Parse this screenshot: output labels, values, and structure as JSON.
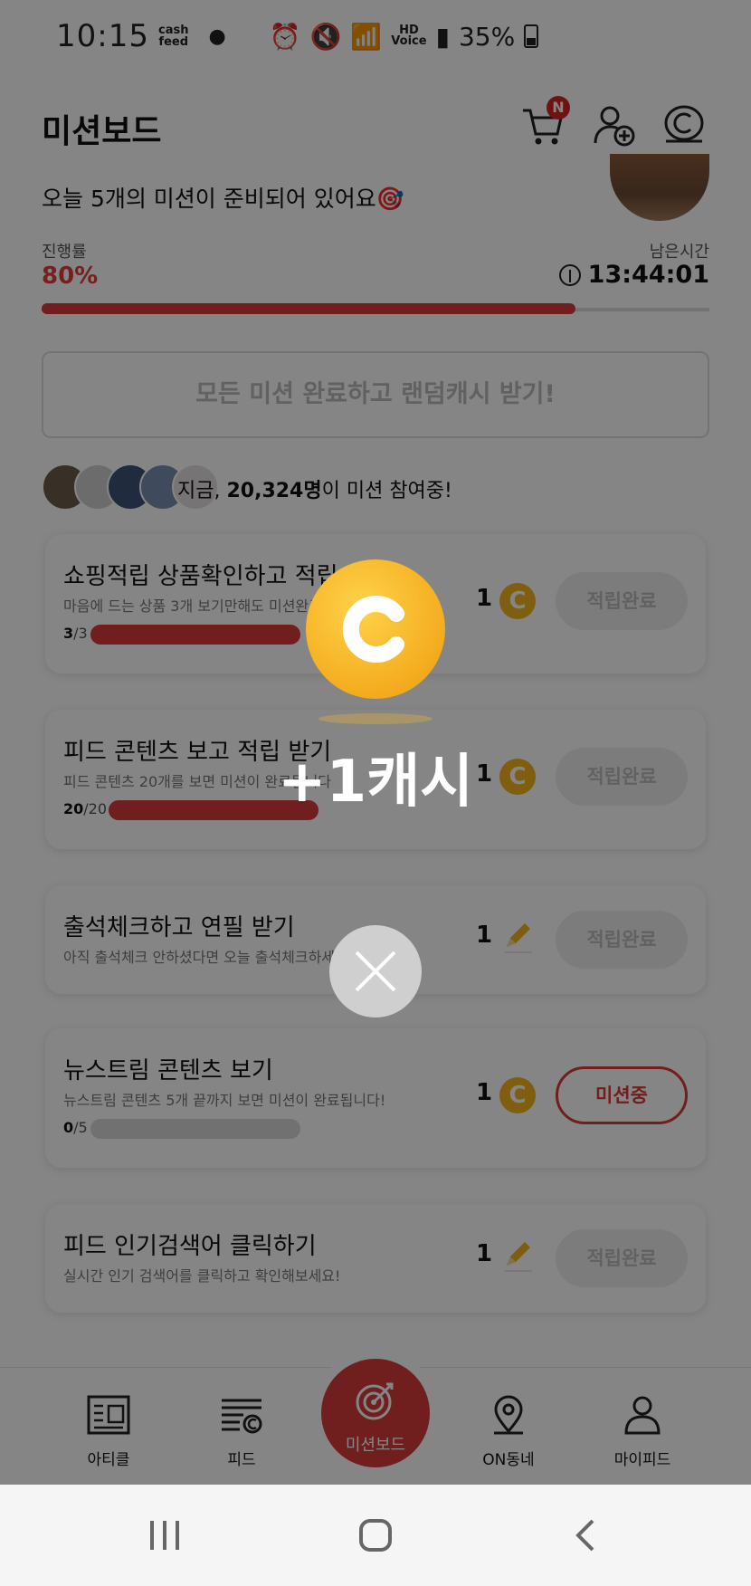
{
  "status_bar": {
    "time": "10:15",
    "cashfeed": "cash\nfeed",
    "battery": "35%",
    "hd": "HD\nVoice"
  },
  "header": {
    "title": "미션보드",
    "cart_badge": "N"
  },
  "summary": {
    "greeting": "오늘 5개의 미션이 준비되어 있어요🎯",
    "progress_label": "진행률",
    "progress_value": "80%",
    "progress_fraction": 0.8,
    "remaining_label": "남은시간",
    "remaining_value": "13:44:01",
    "all_complete_button": "모든 미션 완료하고 랜덤캐시 받기!",
    "participants_prefix": "지금, ",
    "participants_count": "20,324명",
    "participants_suffix": "이 미션 참여중!"
  },
  "missions": [
    {
      "title": "쇼핑적립 상품확인하고 적립",
      "desc": "마음에 드는 상품 3개 보기만해도 미션완료",
      "done": "3",
      "total": "/3",
      "fraction": 1.0,
      "reward": "1",
      "reward_icon": "coin-icon",
      "button": "적립완료",
      "state": "complete"
    },
    {
      "title": "피드 콘텐츠 보고 적립 받기",
      "desc": "피드 콘텐츠 20개를 보면 미션이 완료됩니다",
      "done": "20",
      "total": "/20",
      "fraction": 1.0,
      "reward": "1",
      "reward_icon": "coin-icon",
      "button": "적립완료",
      "state": "complete"
    },
    {
      "title": "출석체크하고 연필 받기",
      "desc": "아직 출석체크 안하셨다면 오늘 출석체크하세요",
      "reward": "1",
      "reward_icon": "pencil-icon",
      "button": "적립완료",
      "state": "complete"
    },
    {
      "title": "뉴스트림 콘텐츠 보기",
      "desc": "뉴스트림 콘텐츠 5개 끝까지 보면 미션이 완료됩니다!",
      "done": "0",
      "total": "/5",
      "fraction": 0.0,
      "reward": "1",
      "reward_icon": "coin-icon",
      "button": "미션중",
      "state": "active"
    },
    {
      "title": "피드 인기검색어 클릭하기",
      "desc": "실시간 인기 검색어를 클릭하고 확인해보세요!",
      "reward": "1",
      "reward_icon": "pencil-icon",
      "button": "적립완료",
      "state": "complete"
    }
  ],
  "nav": {
    "items": [
      {
        "label": "아티클",
        "icon": "article-icon"
      },
      {
        "label": "피드",
        "icon": "feed-icon"
      },
      {
        "label": "미션보드",
        "icon": "target-icon"
      },
      {
        "label": "ON동네",
        "icon": "location-pin-icon"
      },
      {
        "label": "마이피드",
        "icon": "person-icon"
      }
    ]
  },
  "overlay": {
    "reward_text": "+1캐시"
  },
  "colors": {
    "accent": "#d63a3a",
    "coin": "#f4b41d"
  }
}
